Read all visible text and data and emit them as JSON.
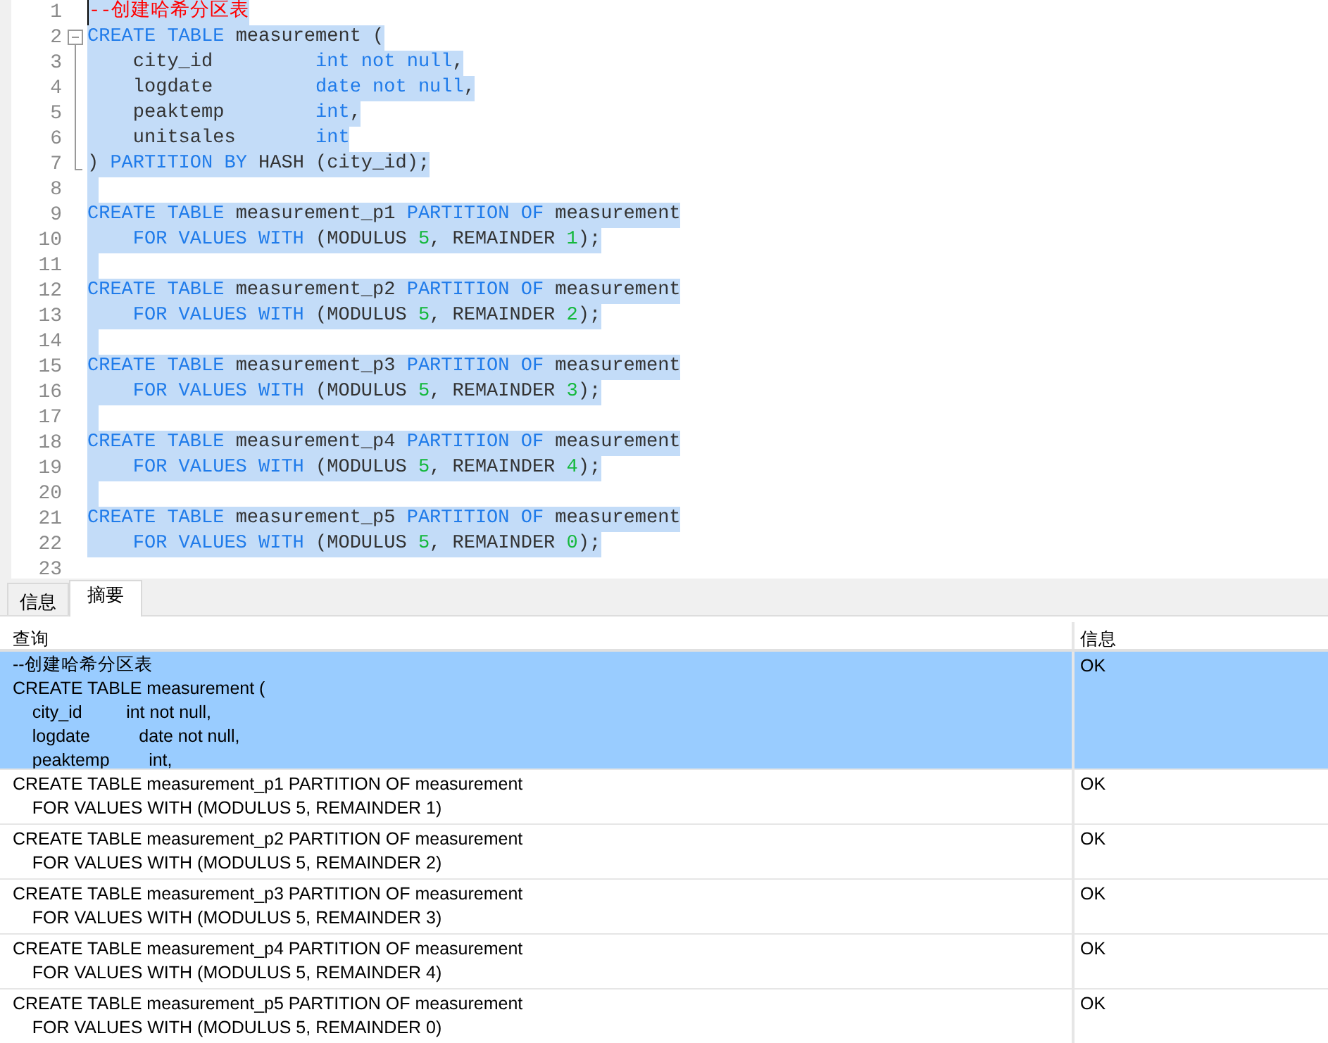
{
  "editor": {
    "lines": [
      {
        "number": "1",
        "selected": true,
        "cursor": true,
        "tokens": [
          {
            "kind": "comment",
            "text": "--创建哈希分区表"
          }
        ]
      },
      {
        "number": "2",
        "selected": true,
        "fold_start": true,
        "tokens": [
          {
            "kind": "keyword",
            "text": "CREATE TABLE"
          },
          {
            "kind": "plain",
            "text": " measurement ("
          }
        ]
      },
      {
        "number": "3",
        "selected": true,
        "in_fold": true,
        "tokens": [
          {
            "kind": "plain",
            "text": "    city_id         "
          },
          {
            "kind": "keyword",
            "text": "int not null"
          },
          {
            "kind": "plain",
            "text": ","
          }
        ]
      },
      {
        "number": "4",
        "selected": true,
        "in_fold": true,
        "tokens": [
          {
            "kind": "plain",
            "text": "    logdate         "
          },
          {
            "kind": "keyword",
            "text": "date not null"
          },
          {
            "kind": "plain",
            "text": ","
          }
        ]
      },
      {
        "number": "5",
        "selected": true,
        "in_fold": true,
        "tokens": [
          {
            "kind": "plain",
            "text": "    peaktemp        "
          },
          {
            "kind": "keyword",
            "text": "int"
          },
          {
            "kind": "plain",
            "text": ","
          }
        ]
      },
      {
        "number": "6",
        "selected": true,
        "in_fold": true,
        "tokens": [
          {
            "kind": "plain",
            "text": "    unitsales       "
          },
          {
            "kind": "keyword",
            "text": "int"
          }
        ]
      },
      {
        "number": "7",
        "selected": true,
        "fold_end": true,
        "tokens": [
          {
            "kind": "plain",
            "text": ") "
          },
          {
            "kind": "keyword",
            "text": "PARTITION BY"
          },
          {
            "kind": "plain",
            "text": " HASH (city_id);"
          }
        ]
      },
      {
        "number": "8",
        "selected": true
      },
      {
        "number": "9",
        "selected": true,
        "tokens": [
          {
            "kind": "keyword",
            "text": "CREATE TABLE"
          },
          {
            "kind": "plain",
            "text": " measurement_p1 "
          },
          {
            "kind": "keyword",
            "text": "PARTITION OF"
          },
          {
            "kind": "plain",
            "text": " measurement"
          }
        ]
      },
      {
        "number": "10",
        "selected": true,
        "indented": true,
        "tokens": [
          {
            "kind": "keyword",
            "text": "FOR VALUES WITH"
          },
          {
            "kind": "plain",
            "text": " (MODULUS "
          },
          {
            "kind": "number",
            "text": "5"
          },
          {
            "kind": "plain",
            "text": ", REMAINDER "
          },
          {
            "kind": "number",
            "text": "1"
          },
          {
            "kind": "plain",
            "text": ");"
          }
        ]
      },
      {
        "number": "11",
        "selected": true
      },
      {
        "number": "12",
        "selected": true,
        "tokens": [
          {
            "kind": "keyword",
            "text": "CREATE TABLE"
          },
          {
            "kind": "plain",
            "text": " measurement_p2 "
          },
          {
            "kind": "keyword",
            "text": "PARTITION OF"
          },
          {
            "kind": "plain",
            "text": " measurement"
          }
        ]
      },
      {
        "number": "13",
        "selected": true,
        "indented": true,
        "tokens": [
          {
            "kind": "keyword",
            "text": "FOR VALUES WITH"
          },
          {
            "kind": "plain",
            "text": " (MODULUS "
          },
          {
            "kind": "number",
            "text": "5"
          },
          {
            "kind": "plain",
            "text": ", REMAINDER "
          },
          {
            "kind": "number",
            "text": "2"
          },
          {
            "kind": "plain",
            "text": ");"
          }
        ]
      },
      {
        "number": "14",
        "selected": true
      },
      {
        "number": "15",
        "selected": true,
        "tokens": [
          {
            "kind": "keyword",
            "text": "CREATE TABLE"
          },
          {
            "kind": "plain",
            "text": " measurement_p3 "
          },
          {
            "kind": "keyword",
            "text": "PARTITION OF"
          },
          {
            "kind": "plain",
            "text": " measurement"
          }
        ]
      },
      {
        "number": "16",
        "selected": true,
        "indented": true,
        "tokens": [
          {
            "kind": "keyword",
            "text": "FOR VALUES WITH"
          },
          {
            "kind": "plain",
            "text": " (MODULUS "
          },
          {
            "kind": "number",
            "text": "5"
          },
          {
            "kind": "plain",
            "text": ", REMAINDER "
          },
          {
            "kind": "number",
            "text": "3"
          },
          {
            "kind": "plain",
            "text": ");"
          }
        ]
      },
      {
        "number": "17",
        "selected": true
      },
      {
        "number": "18",
        "selected": true,
        "tokens": [
          {
            "kind": "keyword",
            "text": "CREATE TABLE"
          },
          {
            "kind": "plain",
            "text": " measurement_p4 "
          },
          {
            "kind": "keyword",
            "text": "PARTITION OF"
          },
          {
            "kind": "plain",
            "text": " measurement"
          }
        ]
      },
      {
        "number": "19",
        "selected": true,
        "indented": true,
        "tokens": [
          {
            "kind": "keyword",
            "text": "FOR VALUES WITH"
          },
          {
            "kind": "plain",
            "text": " (MODULUS "
          },
          {
            "kind": "number",
            "text": "5"
          },
          {
            "kind": "plain",
            "text": ", REMAINDER "
          },
          {
            "kind": "number",
            "text": "4"
          },
          {
            "kind": "plain",
            "text": ");"
          }
        ]
      },
      {
        "number": "20",
        "selected": true
      },
      {
        "number": "21",
        "selected": true,
        "tokens": [
          {
            "kind": "keyword",
            "text": "CREATE TABLE"
          },
          {
            "kind": "plain",
            "text": " measurement_p5 "
          },
          {
            "kind": "keyword",
            "text": "PARTITION OF"
          },
          {
            "kind": "plain",
            "text": " measurement"
          }
        ]
      },
      {
        "number": "22",
        "selected": true,
        "indented": true,
        "tokens": [
          {
            "kind": "keyword",
            "text": "FOR VALUES WITH"
          },
          {
            "kind": "plain",
            "text": " (MODULUS "
          },
          {
            "kind": "number",
            "text": "5"
          },
          {
            "kind": "plain",
            "text": ", REMAINDER "
          },
          {
            "kind": "number",
            "text": "0"
          },
          {
            "kind": "plain",
            "text": ");"
          }
        ]
      },
      {
        "number": "23"
      }
    ]
  },
  "tabs": [
    {
      "label": "信息",
      "selected": false
    },
    {
      "label": "摘要",
      "selected": true
    }
  ],
  "results": {
    "columns": [
      "查询",
      "信息"
    ],
    "rows": [
      {
        "selected": true,
        "query_lines": [
          "--创建哈希分区表",
          "CREATE TABLE measurement (",
          "    city_id         int not null,",
          "    logdate          date not null,",
          "    peaktemp        int,"
        ],
        "info": "OK"
      },
      {
        "selected": false,
        "query_lines": [
          "CREATE TABLE measurement_p1 PARTITION OF measurement",
          "    FOR VALUES WITH (MODULUS 5, REMAINDER 1)"
        ],
        "info": "OK"
      },
      {
        "selected": false,
        "query_lines": [
          "CREATE TABLE measurement_p2 PARTITION OF measurement",
          "    FOR VALUES WITH (MODULUS 5, REMAINDER 2)"
        ],
        "info": "OK"
      },
      {
        "selected": false,
        "query_lines": [
          "CREATE TABLE measurement_p3 PARTITION OF measurement",
          "    FOR VALUES WITH (MODULUS 5, REMAINDER 3)"
        ],
        "info": "OK"
      },
      {
        "selected": false,
        "query_lines": [
          "CREATE TABLE measurement_p4 PARTITION OF measurement",
          "    FOR VALUES WITH (MODULUS 5, REMAINDER 4)"
        ],
        "info": "OK"
      },
      {
        "selected": false,
        "query_lines": [
          "CREATE TABLE measurement_p5 PARTITION OF measurement",
          "    FOR VALUES WITH (MODULUS 5, REMAINDER 0)"
        ],
        "info": "OK"
      }
    ]
  }
}
